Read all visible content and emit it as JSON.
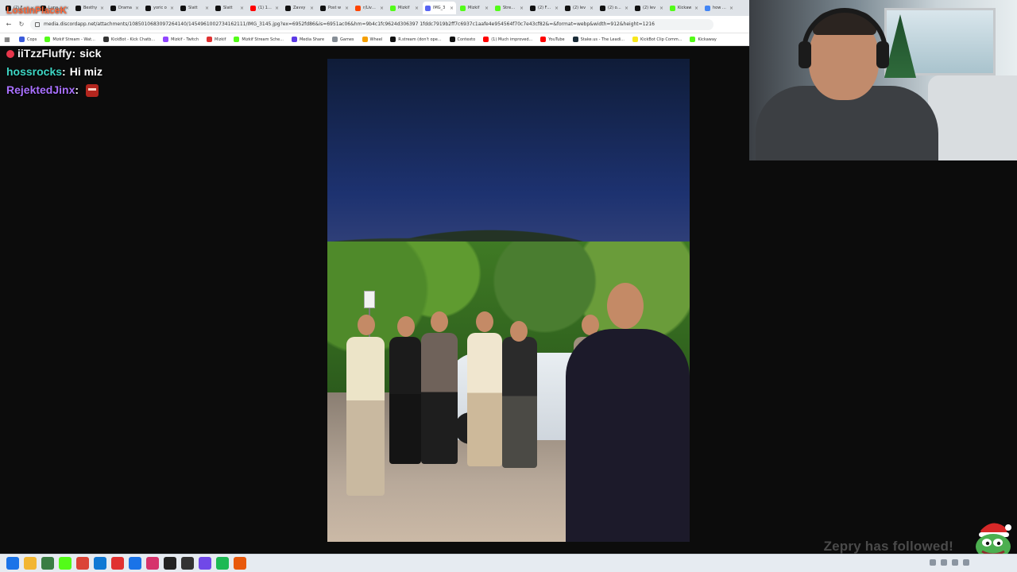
{
  "browser": {
    "tabs": [
      {
        "label": "(2) FaZe",
        "icon": "x-icon",
        "color": "#111111"
      },
      {
        "label": "Lunar...",
        "icon": "x-icon",
        "color": "#111111"
      },
      {
        "label": "Besthy",
        "icon": "x-icon",
        "color": "#111111"
      },
      {
        "label": "Drama",
        "icon": "x-icon",
        "color": "#111111"
      },
      {
        "label": "yoric o",
        "icon": "x-icon",
        "color": "#111111"
      },
      {
        "label": "Slatt",
        "icon": "x-icon",
        "color": "#111111"
      },
      {
        "label": "Slatt",
        "icon": "x-icon",
        "color": "#111111"
      },
      {
        "label": "(1) 100",
        "icon": "youtube-icon",
        "color": "#ff0000"
      },
      {
        "label": "Zavvy",
        "icon": "x-icon",
        "color": "#111111"
      },
      {
        "label": "Post w",
        "icon": "x-icon",
        "color": "#111111"
      },
      {
        "label": "r/Livest",
        "icon": "reddit-icon",
        "color": "#ff4500"
      },
      {
        "label": "Mizkif",
        "icon": "kick-icon",
        "color": "#53fc18"
      },
      {
        "label": "IMG_3",
        "icon": "discord-icon",
        "color": "#5865f2"
      },
      {
        "label": "Mizkif",
        "icon": "kick-icon",
        "color": "#53fc18"
      },
      {
        "label": "Stream",
        "icon": "kick-icon",
        "color": "#53fc18"
      },
      {
        "label": "(2) FaZe",
        "icon": "x-icon",
        "color": "#111111"
      },
      {
        "label": "(2) lev",
        "icon": "x-icon",
        "color": "#111111"
      },
      {
        "label": "(2) occi",
        "icon": "x-icon",
        "color": "#111111"
      },
      {
        "label": "(2) lev",
        "icon": "x-icon",
        "color": "#111111"
      },
      {
        "label": "Kickaw",
        "icon": "kick-icon",
        "color": "#53fc18"
      },
      {
        "label": "how do",
        "icon": "google-icon",
        "color": "#4285f4"
      }
    ],
    "url": "media.discordapp.net/attachments/1085010683097264140/1454961002734162111/IMG_3145.jpg?ex=6952fd86&is=6951ac06&hm=9b4c1fc9624d306397 1fddc7919b2ff7c6937c1aafe4e954564f70c7e43cf82&=&format=webp&width=912&height=1216",
    "bookmarks": [
      {
        "label": "Cops",
        "color": "#3b5bdb"
      },
      {
        "label": "Mizkif Stream - Wat...",
        "color": "#53fc18"
      },
      {
        "label": "KickBot - Kick Chatb...",
        "color": "#333333"
      },
      {
        "label": "Mizkif - Twitch",
        "color": "#9146ff"
      },
      {
        "label": "Mizkif",
        "color": "#e03131"
      },
      {
        "label": "Mizkif Stream Sche...",
        "color": "#53fc18"
      },
      {
        "label": "Media Share",
        "color": "#5c3ae6"
      },
      {
        "label": "Games",
        "color": "#868e96"
      },
      {
        "label": "Wheel",
        "color": "#f59f00"
      },
      {
        "label": "R.stream (don't ope...",
        "color": "#111111"
      },
      {
        "label": "Contexto",
        "color": "#111111"
      },
      {
        "label": "(1) Much improved...",
        "color": "#ff0000"
      },
      {
        "label": "YouTube",
        "color": "#ff0000"
      },
      {
        "label": "Stake.us - The Leadi...",
        "color": "#1a2c38"
      },
      {
        "label": "KickBot Clip Comm...",
        "color": "#f8e71c"
      },
      {
        "label": "Kickaway",
        "color": "#53fc18"
      }
    ]
  },
  "overlay": {
    "top_name": "LostInPlaceK"
  },
  "chat": [
    {
      "user": "iiTzzFluffy",
      "message": "sick",
      "user_color": "#f2f2f2",
      "badge": true,
      "emote": false
    },
    {
      "user": "hossrocks",
      "message": "Hi miz",
      "user_color": "#3dd6c4",
      "badge": false,
      "emote": false
    },
    {
      "user": "RejektedJinx",
      "message": "",
      "user_color": "#a970ff",
      "badge": false,
      "emote": true
    }
  ],
  "alert": {
    "follow_text": "Zepry has followed!"
  },
  "taskbar": {
    "icons": [
      {
        "name": "windows-start-icon",
        "color": "#1a73e8"
      },
      {
        "name": "file-explorer-icon",
        "color": "#f2b632"
      },
      {
        "name": "app-icon",
        "color": "#3a7d44"
      },
      {
        "name": "kick-app-icon",
        "color": "#53fc18"
      },
      {
        "name": "chrome-icon",
        "color": "#db4437"
      },
      {
        "name": "edge-icon",
        "color": "#0f78d4"
      },
      {
        "name": "app-icon",
        "color": "#e03131"
      },
      {
        "name": "app-icon",
        "color": "#1a73e8"
      },
      {
        "name": "app-icon",
        "color": "#d6336c"
      },
      {
        "name": "obs-icon",
        "color": "#222222"
      },
      {
        "name": "app-icon",
        "color": "#333333"
      },
      {
        "name": "app-icon",
        "color": "#7048e8"
      },
      {
        "name": "spotify-icon",
        "color": "#1db954"
      },
      {
        "name": "app-icon",
        "color": "#e8590c"
      }
    ]
  }
}
